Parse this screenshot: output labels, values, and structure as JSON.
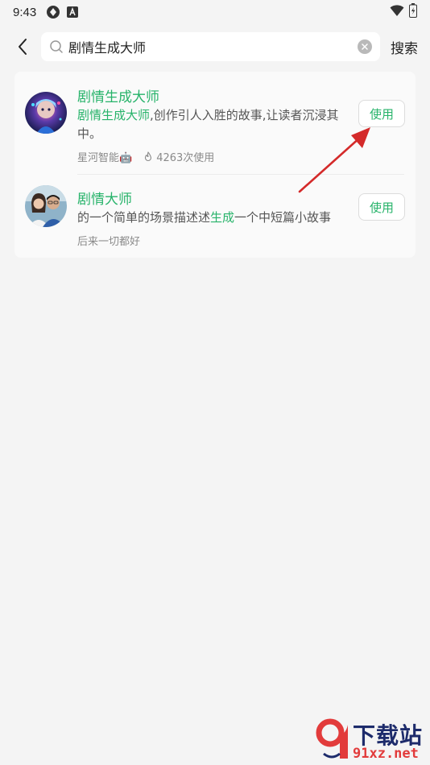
{
  "status_bar": {
    "time": "9:43",
    "icons": [
      "sync-icon",
      "app-a-icon",
      "wifi-icon",
      "battery-icon"
    ]
  },
  "header": {
    "search_value": "剧情生成大师",
    "search_button_label": "搜索"
  },
  "results": [
    {
      "title": "剧情生成大师",
      "description_highlight": "剧情生成大师",
      "description_rest": ",创作引人入胜的故事,让读者沉浸其中。",
      "author": "星河智能🤖",
      "usage": "4263次使用",
      "button_label": "使用"
    },
    {
      "title": "剧情大师",
      "description_before": "的一个简单的场景描述述",
      "description_highlight": "生成",
      "description_after": "一个中短篇小故事",
      "author": "后来一切都好",
      "button_label": "使用"
    }
  ],
  "watermark": {
    "title": "下载站",
    "url": "91xz.net"
  },
  "colors": {
    "accent_green": "#27b36a",
    "background": "#f4f4f4",
    "card": "#fafafa",
    "annotation_arrow": "#d42a2a"
  }
}
